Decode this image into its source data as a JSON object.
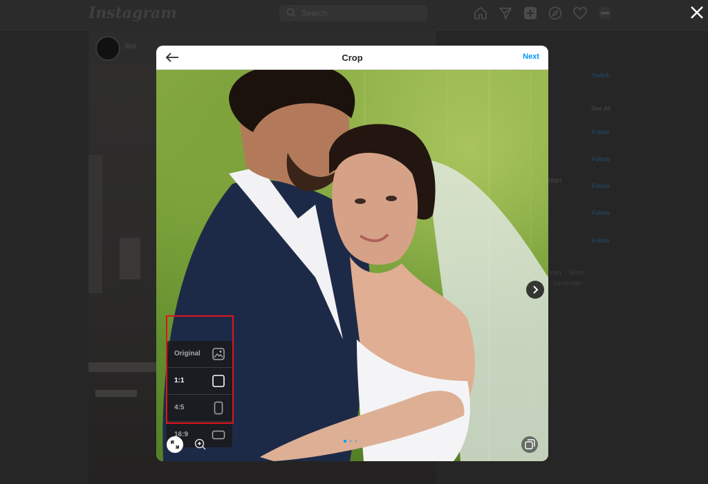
{
  "background": {
    "logo": "Instagram",
    "search_placeholder": "Search",
    "post_user": "dior",
    "suggestions": {
      "switch_label": "Switch",
      "see_all_label": "See All",
      "follow_label": "Follow",
      "partial_name": "nian",
      "footer_line1": "vacy · Terms",
      "footer_line2": "· Language"
    }
  },
  "modal": {
    "title": "Crop",
    "next_label": "Next",
    "crop_options": [
      {
        "label": "Original",
        "icon": "image-icon",
        "selected": false
      },
      {
        "label": "1:1",
        "icon": "square-icon",
        "selected": true
      },
      {
        "label": "4:5",
        "icon": "portrait-rect-icon",
        "selected": false
      },
      {
        "label": "16:9",
        "icon": "landscape-rect-icon",
        "selected": false
      }
    ],
    "carousel": {
      "count": 3,
      "active": 0
    }
  },
  "colors": {
    "accent": "#0095f6",
    "highlight": "#e0141e"
  }
}
